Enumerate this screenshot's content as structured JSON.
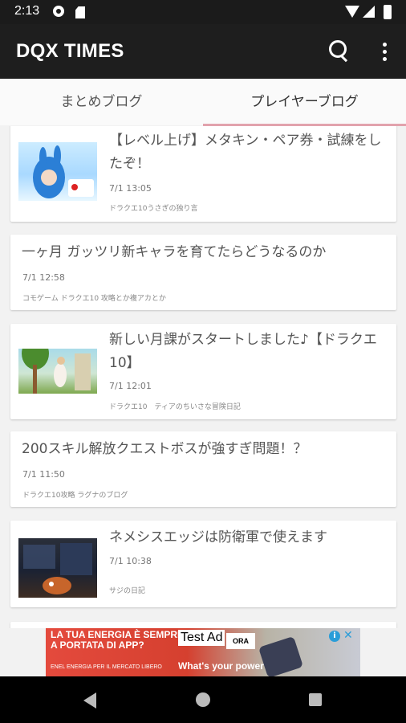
{
  "status_bar": {
    "time": "2:13"
  },
  "app_bar": {
    "title": "DQX TIMES"
  },
  "tabs": [
    {
      "label": "まとめブログ",
      "selected": false
    },
    {
      "label": "プレイヤーブログ",
      "selected": true
    }
  ],
  "accent_color": "#e2a3ad",
  "articles": [
    {
      "title_line1": "【レベル上げ】メタキン・ペア券・試練をし",
      "title_line2": "たぞ！",
      "date": "7/1 13:05",
      "source": "ドラクエ10うさぎの独り言",
      "has_thumbnail": true
    },
    {
      "title_line1": "一ヶ月 ガッツリ新キャラを育てたらどうなるのか",
      "date": "7/1 12:58",
      "source": "コモゲーム ドラクエ10 攻略とか複アカとか",
      "has_thumbnail": false
    },
    {
      "title_line1": "新しい月課がスタートしました♪【ドラクエ",
      "title_line2": "10】",
      "date": "7/1 12:01",
      "source": "ドラクエ10　ティアのちいさな冒険日記",
      "has_thumbnail": true
    },
    {
      "title_line1": "200スキル解放クエストボスが強すぎ問題！？",
      "date": "7/1 11:50",
      "source": "ドラクエ10攻略 ラグナのブログ",
      "has_thumbnail": false
    },
    {
      "title_line1": "ネメシスエッジは防衛軍で使えます",
      "date": "7/1 10:38",
      "source": "サジの日記",
      "has_thumbnail": true
    }
  ],
  "ad": {
    "headline": "LA TUA ENERGIA È SEMPRE A PORTATA DI APP?",
    "label": "Test Ad",
    "button": "ORA",
    "tagline": "What's your power?",
    "fine_print": "ENEL ENERGIA PER IL MERCATO LIBERO",
    "info_icon": "i",
    "close_icon": "✕"
  }
}
